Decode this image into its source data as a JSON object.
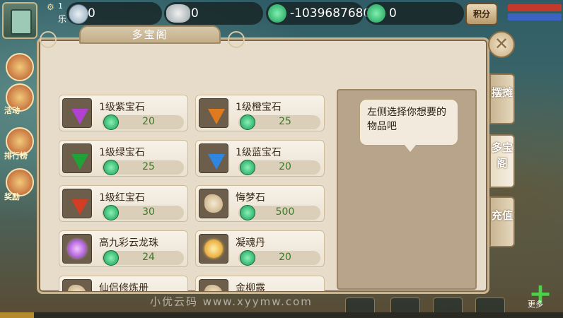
{
  "top": {
    "level_text": "1",
    "player_text": "乐",
    "contribution": "0",
    "silver": "0",
    "jade": "-1039687680",
    "bound_jade": "0",
    "score_label": "积分"
  },
  "side": {
    "event_label": "活动",
    "rank_label": "排行榜",
    "reward_label": "奖励"
  },
  "panel": {
    "title": "多宝阁",
    "hint_text": "左侧选择你想要的物品吧"
  },
  "items": [
    {
      "name": "1级紫宝石",
      "price": "20",
      "icon": "purple-gem-icon",
      "color": "#b041d1"
    },
    {
      "name": "1级橙宝石",
      "price": "25",
      "icon": "orange-gem-icon",
      "color": "#e07a1f"
    },
    {
      "name": "1级绿宝石",
      "price": "25",
      "icon": "green-gem-icon",
      "color": "#1fa336"
    },
    {
      "name": "1级蓝宝石",
      "price": "20",
      "icon": "blue-gem-icon",
      "color": "#2d86e0"
    },
    {
      "name": "1级红宝石",
      "price": "30",
      "icon": "red-gem-icon",
      "color": "#d23d24"
    },
    {
      "name": "悔梦石",
      "price": "500",
      "icon": "dream-stone-icon"
    },
    {
      "name": "高九彩云龙珠",
      "price": "24",
      "icon": "dragon-pearl-icon"
    },
    {
      "name": "凝魂丹",
      "price": "20",
      "icon": "soul-pill-icon"
    },
    {
      "name": "仙侣修炼册",
      "price": "",
      "icon": "book-icon"
    },
    {
      "name": "金柳露",
      "price": "",
      "icon": "dew-icon"
    }
  ],
  "tabs": {
    "stall": "摆摊",
    "treasure": "多宝阁",
    "recharge": "充值"
  },
  "bottom": {
    "more_label": "更多",
    "watermark": "小优云码 www.xyymw.com"
  }
}
